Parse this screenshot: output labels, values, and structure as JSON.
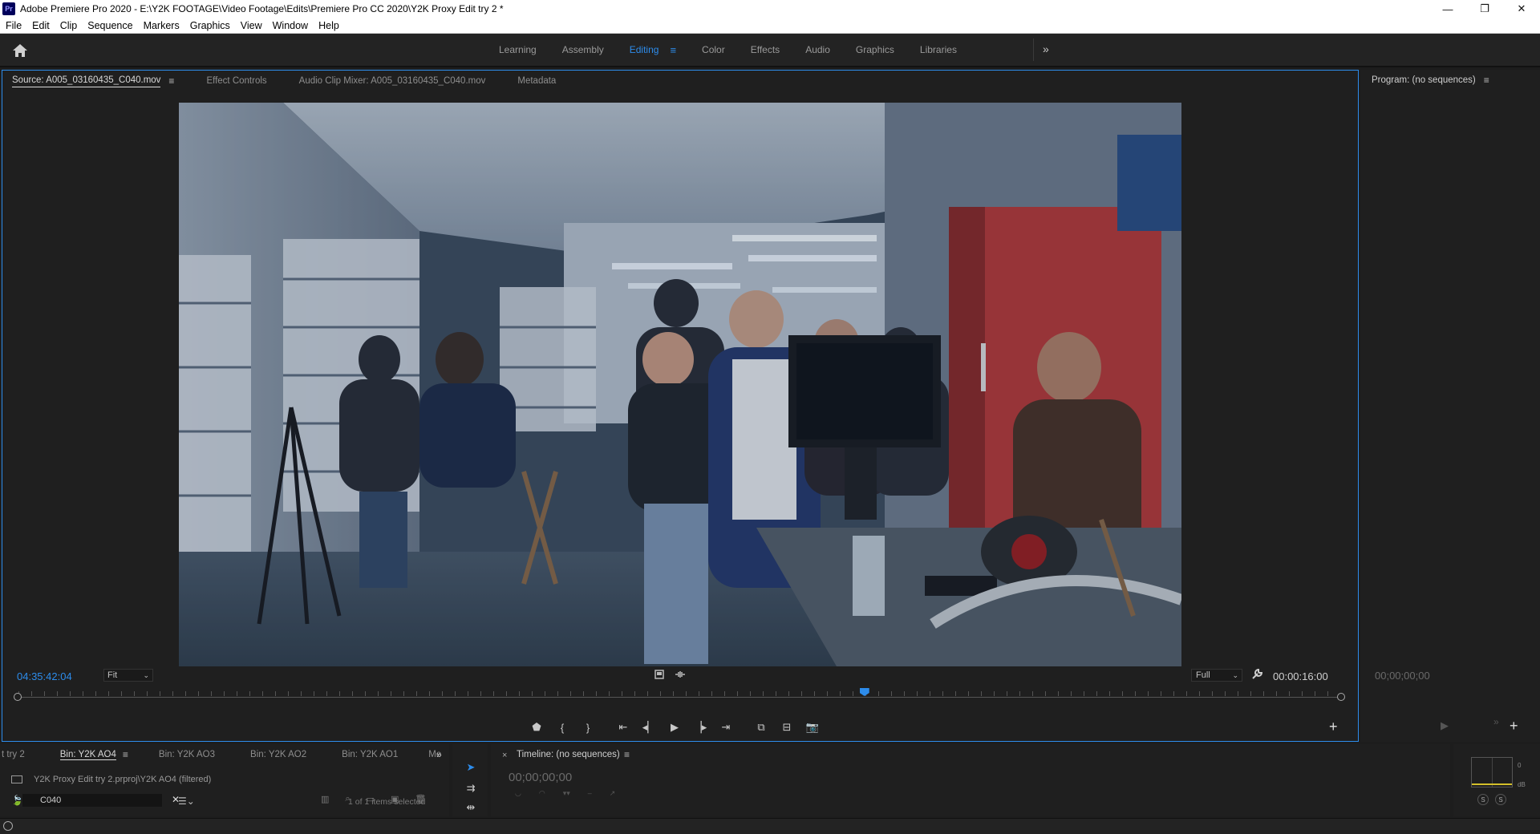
{
  "window": {
    "app_badge": "Pr",
    "title": "Adobe Premiere Pro 2020 - E:\\Y2K FOOTAGE\\Video Footage\\Edits\\Premiere Pro CC 2020\\Y2K Proxy Edit try 2 *",
    "minimize": "—",
    "restore": "❐",
    "close": "✕"
  },
  "menu": [
    "File",
    "Edit",
    "Clip",
    "Sequence",
    "Markers",
    "Graphics",
    "View",
    "Window",
    "Help"
  ],
  "workspaces": {
    "tabs": [
      "Learning",
      "Assembly",
      "Editing",
      "Color",
      "Effects",
      "Audio",
      "Graphics",
      "Libraries"
    ],
    "active": "Editing",
    "more": "»"
  },
  "source_panel": {
    "tabs": [
      {
        "label": "Source: A005_03160435_C040.mov",
        "active": true
      },
      {
        "label": "Effect Controls",
        "active": false
      },
      {
        "label": "Audio Clip Mixer: A005_03160435_C040.mov",
        "active": false
      },
      {
        "label": "Metadata",
        "active": false
      }
    ],
    "timecode": "04:35:42:04",
    "zoom": "Fit",
    "resolution": "Full",
    "duration": "00:00:16:00",
    "playhead_fraction": 0.64,
    "add_button": "+"
  },
  "program_panel": {
    "tab": "Program: (no sequences)",
    "timecode": "00;00;00;00",
    "add_button": "+"
  },
  "project_panel": {
    "tabs": [
      {
        "label": "t try 2",
        "active": false
      },
      {
        "label": "Bin: Y2K AO4",
        "active": true
      },
      {
        "label": "Bin: Y2K AO3",
        "active": false
      },
      {
        "label": "Bin: Y2K AO2",
        "active": false
      },
      {
        "label": "Bin: Y2K AO1",
        "active": false
      },
      {
        "label": "Me",
        "active": false
      }
    ],
    "more": "»",
    "path": "Y2K Proxy Edit try 2.prproj\\Y2K AO4 (filtered)",
    "search_value": "C040",
    "items_selected": "1 of 1 items selected"
  },
  "timeline_panel": {
    "title": "Timeline: (no sequences)",
    "timecode": "00;00;00;00"
  },
  "audio_meter": {
    "zero_label": "0",
    "db_label": "dB",
    "solo_left": "S",
    "solo_right": "S"
  }
}
